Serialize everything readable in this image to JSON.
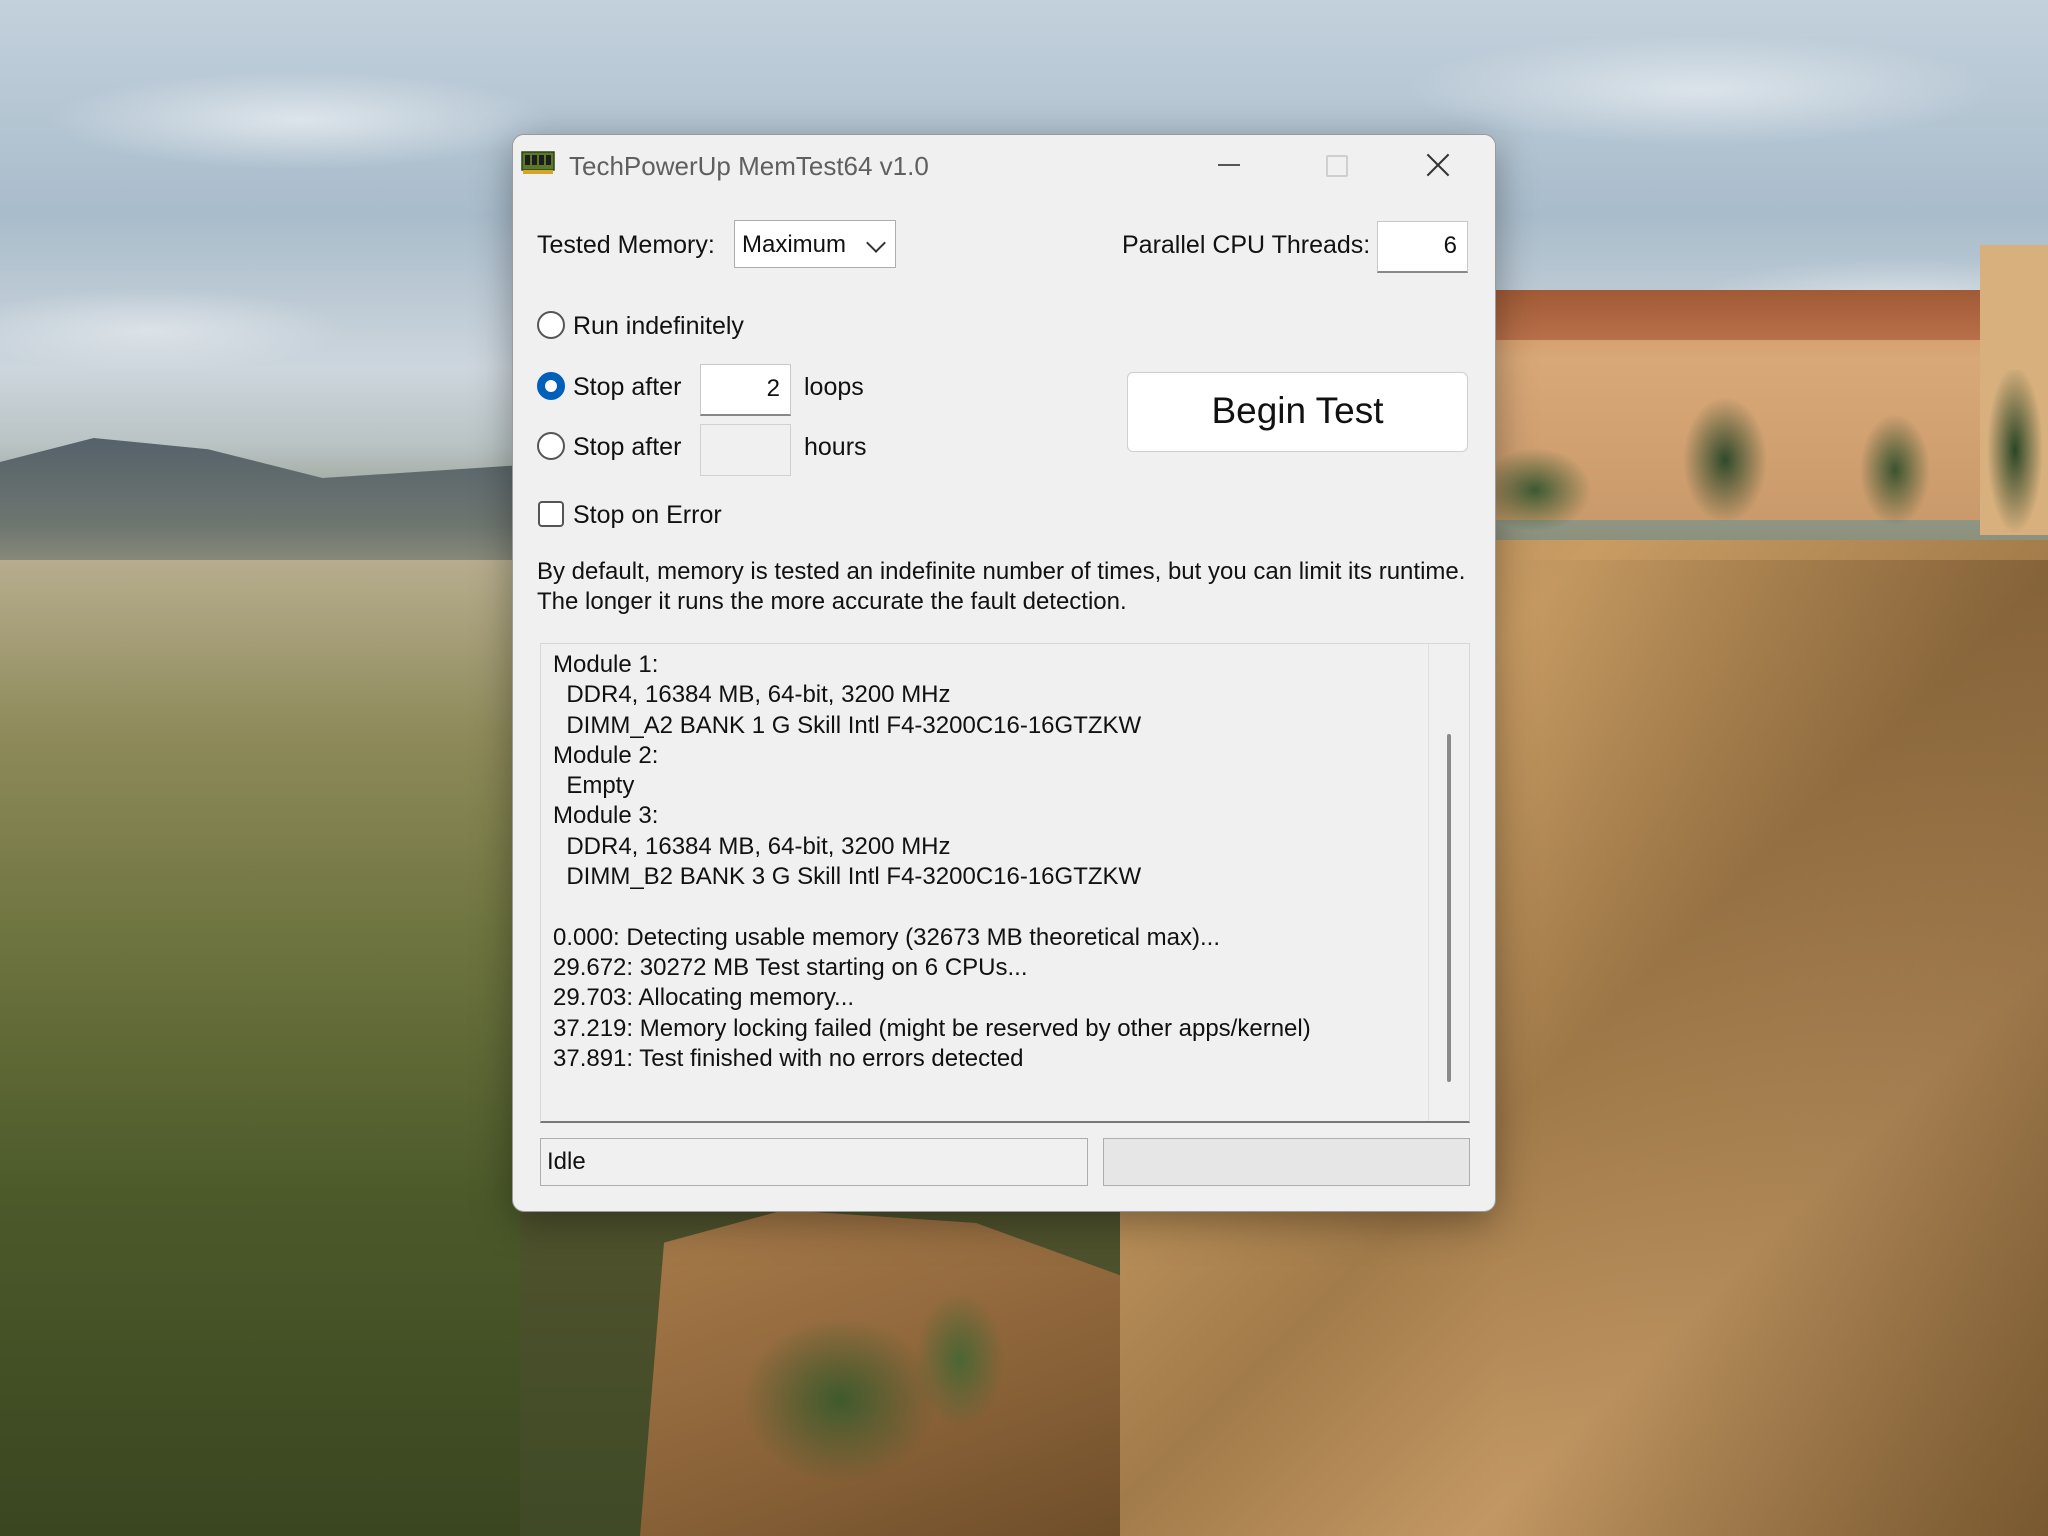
{
  "window": {
    "title": "TechPowerUp MemTest64 v1.0"
  },
  "settings": {
    "tested_memory_label": "Tested Memory:",
    "tested_memory_value": "Maximum",
    "threads_label": "Parallel CPU Threads:",
    "threads_value": "6",
    "run_indefinitely_label": "Run indefinitely",
    "stop_after_label": "Stop after",
    "loops_value": "2",
    "loops_unit": "loops",
    "hours_value": "",
    "hours_unit": "hours",
    "stop_on_error_label": "Stop on Error",
    "selected_mode": "loops"
  },
  "actions": {
    "begin_label": "Begin Test"
  },
  "description": "By default, memory is tested an indefinite number of times, but you can limit its runtime. The longer it runs the more accurate the fault detection.",
  "log": [
    "Module 1:",
    "  DDR4, 16384 MB, 64-bit, 3200 MHz",
    "  DIMM_A2 BANK 1 G Skill Intl F4-3200C16-16GTZKW",
    "Module 2:",
    "  Empty",
    "Module 3:",
    "  DDR4, 16384 MB, 64-bit, 3200 MHz",
    "  DIMM_B2 BANK 3 G Skill Intl F4-3200C16-16GTZKW",
    "",
    "0.000: Detecting usable memory (32673 MB theoretical max)...",
    "29.672: 30272 MB Test starting on 6 CPUs...",
    "29.703: Allocating memory...",
    "37.219: Memory locking failed (might be reserved by other apps/kernel)",
    "37.891: Test finished with no errors detected"
  ],
  "status": {
    "text": "Idle"
  },
  "colors": {
    "accent": "#005fb8",
    "window_bg": "#f0f0f0"
  }
}
